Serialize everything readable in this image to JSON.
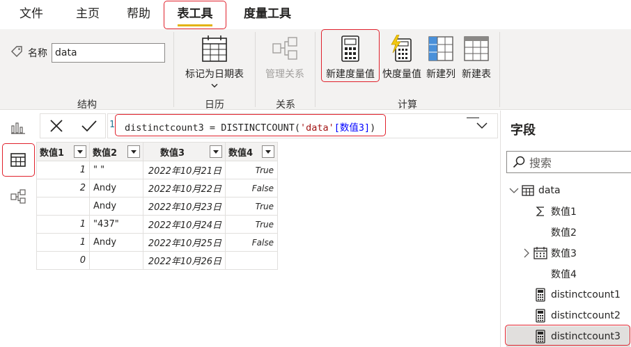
{
  "menu": {
    "file": "文件",
    "home": "主页",
    "help": "帮助",
    "table_tools": "表工具",
    "measure_tools": "度量工具"
  },
  "ribbon": {
    "name_label": "名称",
    "name_value": "data",
    "mark_date_table": "标记为日期表",
    "manage_relationships": "管理关系",
    "new_measure": "新建度量值",
    "quick_measure": "快度量值",
    "new_column": "新建列",
    "new_table": "新建表",
    "groups": {
      "structure": "结构",
      "calendar": "日历",
      "relationships": "关系",
      "calculations": "计算"
    }
  },
  "formula": {
    "line_number": "1",
    "measure_name": "distinctcount3",
    "operator": " = ",
    "function": "DISTINCTCOUNT",
    "open_paren": "(",
    "table_ref": "'data'",
    "column_ref": "[数值3]",
    "close_paren": ")"
  },
  "table": {
    "headers": [
      "数值1",
      "数值2",
      "数值3",
      "数值4"
    ],
    "rows": [
      [
        "1",
        "\" \"",
        "2022年10月21日",
        "True"
      ],
      [
        "2",
        "Andy",
        "2022年10月22日",
        "False"
      ],
      [
        "",
        "Andy",
        "2022年10月23日",
        "True"
      ],
      [
        "1",
        "\"437\"",
        "2022年10月24日",
        "True"
      ],
      [
        "1",
        "Andy",
        "2022年10月25日",
        "False"
      ],
      [
        "0",
        "",
        "2022年10月26日",
        ""
      ]
    ]
  },
  "fields": {
    "title": "字段",
    "search_placeholder": "搜索",
    "table_name": "data",
    "items": [
      {
        "label": "数值1",
        "icon": "sigma-icon"
      },
      {
        "label": "数值2",
        "icon": "none"
      },
      {
        "label": "数值3",
        "icon": "calendar-icon"
      },
      {
        "label": "数值4",
        "icon": "none"
      },
      {
        "label": "distinctcount1",
        "icon": "calculator-icon"
      },
      {
        "label": "distinctcount2",
        "icon": "calculator-icon"
      },
      {
        "label": "distinctcount3",
        "icon": "calculator-icon"
      }
    ]
  },
  "colors": {
    "accent": "#e3b30f",
    "highlight_box": "#e0202b",
    "selected_bg": "#e1dfdd"
  }
}
